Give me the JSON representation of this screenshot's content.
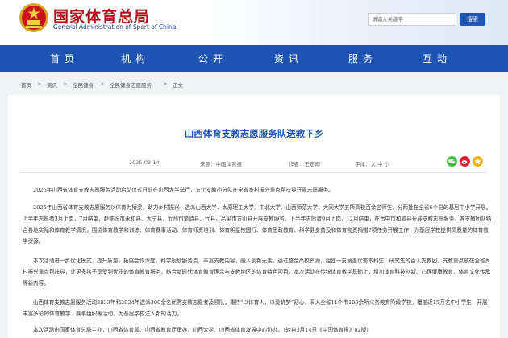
{
  "header": {
    "title": "国家体育总局",
    "subtitle": "General Administration of Sport of China",
    "search_placeholder": "请输入关键字",
    "search_button": "搜索",
    "emblem_icon": "national-emblem-icon"
  },
  "nav": {
    "items": [
      {
        "label": "首页"
      },
      {
        "label": "机构"
      },
      {
        "label": "公开"
      },
      {
        "label": "资讯"
      },
      {
        "label": "服务"
      },
      {
        "label": "互动"
      }
    ]
  },
  "breadcrumb": [
    "首页",
    "资讯",
    "全民健身",
    "全民健身志愿服务",
    "正文"
  ],
  "article": {
    "title": "山西体育支教志愿服务队送教下乡",
    "date": "2025-03-14",
    "source": "来源：中国体育报",
    "author": "作者：王宏卿",
    "font_size": "字体：大 中 小",
    "paragraphs": [
      "2025年山西省体育支教志愿服务活动启动仪式日前在山西大学举行，五个支教小分队在全省乡村振兴重点帮扶县开展志愿服务。",
      "2025年山西省体育支教志愿服务以体育为桥梁，助力乡村振兴，选派山西大学、太原理工大学、中北大学、山西师范大学、大同大学五所高校百余名师生，分两批在全省6个县的基层中小学开展。上半年志愿者3月上岗，7月结束，赴临汾市永和县、大宁县，忻州市繁峙县、代县，吕梁市方山县开展支教服务。下半年志愿者9月上岗，12月结束，在晋中市和顺县开展支教志愿服务。各支教团队结合各地实际和体育教学情况，围绕体育教学和训练、体育赛事活动、体育师资培训、体育明星校园行、体育思政教育、科学健身普及和体育物资捐赠7项任务开展工作，为基层学校提供高质量的体育教学资源。",
      "本次活动进一步优化模式，提升质量，拓展合作深度，科学规划服务点，丰富支教内容，融入创新元素。通过整合高校资源，组建一支涵盖优秀本科生、研究生的百人支教团，支教重点放在全省乡村振兴重点帮扶县，让更多孩子享受到优质的体育教育服务，结合新时代体育教育理念与支教地区的体育特色项目，本次活动在传统体育教学基础上，增加体育科技创新、心理健康教育、体育文化传承等新内容。",
      "山西体育支教志愿服务活动2023年和2024年选派300余名优秀支教志愿者及领队，秉持“以体育人，以爱筑梦”初心，深入全省11个市100余所义务教育阶段学校，覆盖近15万名中小学生，开展丰富多彩的体育教学、赛事组织等活动，为基层学校注入新的活力。",
      "本次活动由国家体育总局主办，山西省体育局、山西省教育厅承办，山西大学、山西省体育发展中心协办。（转自3月14日《中国体育报》02版）"
    ]
  },
  "colors": {
    "brand_red": "#b3121b",
    "nav_blue": "#1e55b4",
    "title_blue": "#1f56b7"
  },
  "share_icons": [
    "wechat-icon",
    "weibo-icon",
    "qzone-icon"
  ]
}
